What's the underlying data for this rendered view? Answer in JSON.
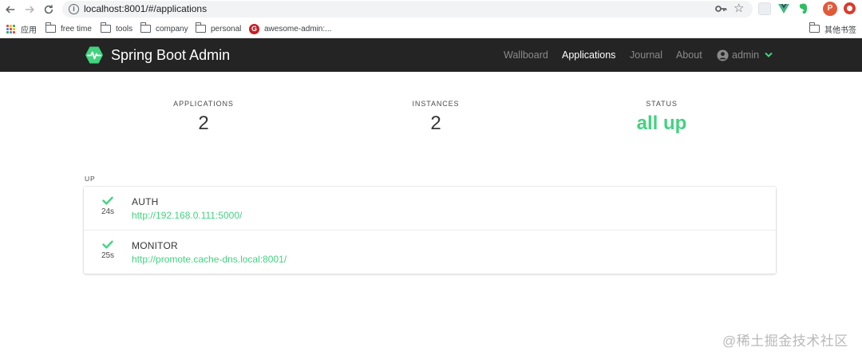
{
  "browser": {
    "url": "localhost:8001/#/applications",
    "profile_initial": "P",
    "bookmarks": [
      {
        "label": "应用",
        "icon": "apps-grid-icon"
      },
      {
        "label": "free time",
        "icon": "folder-icon"
      },
      {
        "label": "tools",
        "icon": "folder-icon"
      },
      {
        "label": "company",
        "icon": "folder-icon"
      },
      {
        "label": "personal",
        "icon": "folder-icon"
      },
      {
        "label": "awesome-admin:...",
        "icon": "gitee-icon"
      }
    ],
    "other_bookmarks": "其他书签"
  },
  "navbar": {
    "brand": "Spring Boot Admin",
    "items": [
      "Wallboard",
      "Applications",
      "Journal",
      "About"
    ],
    "active_item": "Applications",
    "user": "admin"
  },
  "stats": {
    "applications_label": "APPLICATIONS",
    "applications_value": "2",
    "instances_label": "INSTANCES",
    "instances_value": "2",
    "status_label": "STATUS",
    "status_value": "all up"
  },
  "group": {
    "label": "UP",
    "applications": [
      {
        "name": "AUTH",
        "url": "http://192.168.0.111:5000/",
        "uptime": "24s",
        "status": "UP"
      },
      {
        "name": "MONITOR",
        "url": "http://promote.cache-dns.local:8001/",
        "uptime": "25s",
        "status": "UP"
      }
    ]
  },
  "watermark": "@稀土掘金技术社区",
  "colors": {
    "navbar_bg": "#242424",
    "accent_green": "#42d37f",
    "text_dark": "#363636"
  }
}
